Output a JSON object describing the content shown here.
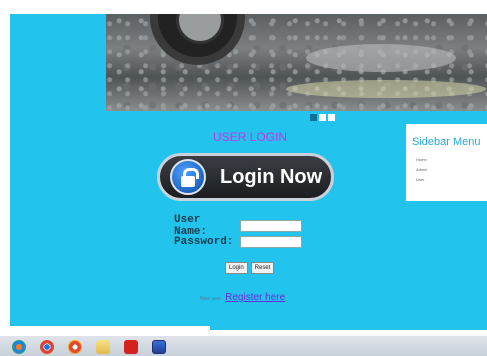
{
  "slider": {
    "dots": [
      "",
      "",
      ""
    ],
    "active_dot": 0
  },
  "login": {
    "title": "USER LOGIN",
    "button_label": "Login Now",
    "username_label": "User Name:",
    "username_value": "",
    "password_label": "Password:",
    "password_value": "",
    "login_label": "Login",
    "reset_label": "Reset"
  },
  "register": {
    "prefix": "New user",
    "link_label": "Register here"
  },
  "sidebar": {
    "title": "Sidebar Menu",
    "items": [
      "Home",
      "Admin",
      "User"
    ]
  },
  "colors": {
    "background": "#22c4ee",
    "title": "#c832e6",
    "link": "#6b2ad8",
    "sidebar_title": "#2aa8d6"
  },
  "taskbar": {
    "icons": [
      "windows-start-icon",
      "chrome-icon",
      "browser-icon",
      "folder-icon",
      "pdf-reader-icon",
      "app-window-icon"
    ]
  }
}
